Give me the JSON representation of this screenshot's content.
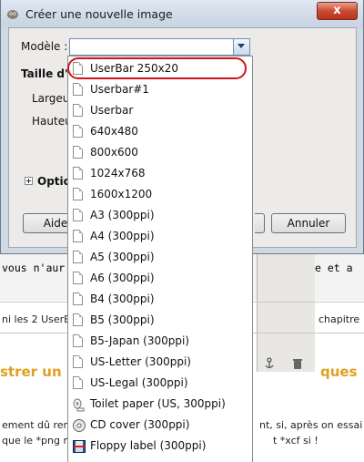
{
  "window": {
    "title": "Créer une nouvelle image",
    "close_glyph": "x"
  },
  "dialog": {
    "template_label": "Modèle :",
    "size_heading": "Taille d'im",
    "width_label": "Largeur",
    "height_label": "Hauteu",
    "options_label": "Option",
    "help_button": "Aide",
    "cancel_button": "Annuler"
  },
  "dropdown": {
    "items": [
      {
        "label": "UserBar 250x20",
        "icon": "page-icon"
      },
      {
        "label": "Userbar#1",
        "icon": "page-icon"
      },
      {
        "label": "Userbar",
        "icon": "page-icon"
      },
      {
        "label": "640x480",
        "icon": "page-icon"
      },
      {
        "label": "800x600",
        "icon": "page-icon"
      },
      {
        "label": "1024x768",
        "icon": "page-icon"
      },
      {
        "label": "1600x1200",
        "icon": "page-icon"
      },
      {
        "label": "A3 (300ppi)",
        "icon": "page-icon"
      },
      {
        "label": "A4 (300ppi)",
        "icon": "page-icon"
      },
      {
        "label": "A5 (300ppi)",
        "icon": "page-icon"
      },
      {
        "label": "A6 (300ppi)",
        "icon": "page-icon"
      },
      {
        "label": "B4 (300ppi)",
        "icon": "page-icon"
      },
      {
        "label": "B5 (300ppi)",
        "icon": "page-icon"
      },
      {
        "label": "B5-Japan (300ppi)",
        "icon": "page-icon"
      },
      {
        "label": "US-Letter (300ppi)",
        "icon": "page-icon"
      },
      {
        "label": "US-Legal (300ppi)",
        "icon": "page-icon"
      },
      {
        "label": "Toilet paper (US, 300ppi)",
        "icon": "toilet-paper-icon"
      },
      {
        "label": "CD cover (300ppi)",
        "icon": "cd-icon"
      },
      {
        "label": "Floppy label (300ppi)",
        "icon": "floppy-icon"
      }
    ],
    "highlighted_index": 0
  },
  "background_page": {
    "code_line_left": "vous n'aur",
    "code_line_right": "e et a",
    "text_left": "ni les 2 UserE",
    "text_right": "chapitre",
    "heading_left": "strer un",
    "heading_right": "ques",
    "para1_left": "ement dû ren",
    "para1_right": "nt, si, après on essai",
    "para2_left": "que le *png r",
    "para2_right": "t *xcf si !"
  },
  "colors": {
    "highlight_ring": "#d0141a",
    "heading_orange": "#e0a020",
    "window_frame": "#cfd9e4"
  }
}
